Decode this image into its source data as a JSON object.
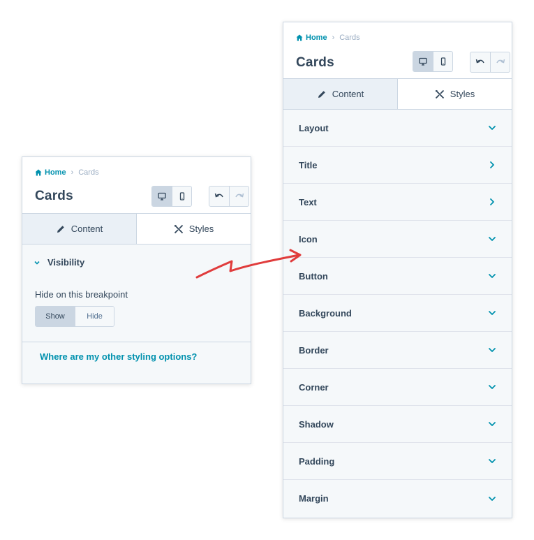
{
  "left_panel": {
    "breadcrumb": {
      "home": "Home",
      "current": "Cards"
    },
    "title": "Cards",
    "tabs": {
      "content": "Content",
      "styles": "Styles"
    },
    "visibility": {
      "label": "Visibility",
      "hide_label": "Hide on this breakpoint",
      "options": [
        "Show",
        "Hide"
      ],
      "selected": "Show"
    },
    "styling_link": "Where are my other styling options?"
  },
  "right_panel": {
    "breadcrumb": {
      "home": "Home",
      "current": "Cards"
    },
    "title": "Cards",
    "tabs": {
      "content": "Content",
      "styles": "Styles"
    },
    "sections": [
      {
        "label": "Layout",
        "icon": "chevron-down-icon"
      },
      {
        "label": "Title",
        "icon": "chevron-right-icon"
      },
      {
        "label": "Text",
        "icon": "chevron-right-icon"
      },
      {
        "label": "Icon",
        "icon": "chevron-down-icon"
      },
      {
        "label": "Button",
        "icon": "chevron-down-icon"
      },
      {
        "label": "Background",
        "icon": "chevron-down-icon"
      },
      {
        "label": "Border",
        "icon": "chevron-down-icon"
      },
      {
        "label": "Corner",
        "icon": "chevron-down-icon"
      },
      {
        "label": "Shadow",
        "icon": "chevron-down-icon"
      },
      {
        "label": "Padding",
        "icon": "chevron-down-icon"
      },
      {
        "label": "Margin",
        "icon": "chevron-down-icon"
      }
    ]
  },
  "colors": {
    "link": "#0091ae",
    "text": "#33475b",
    "border": "#cbd6e2",
    "panel_bg": "#f5f8fa",
    "arrow": "#e03c3c"
  }
}
